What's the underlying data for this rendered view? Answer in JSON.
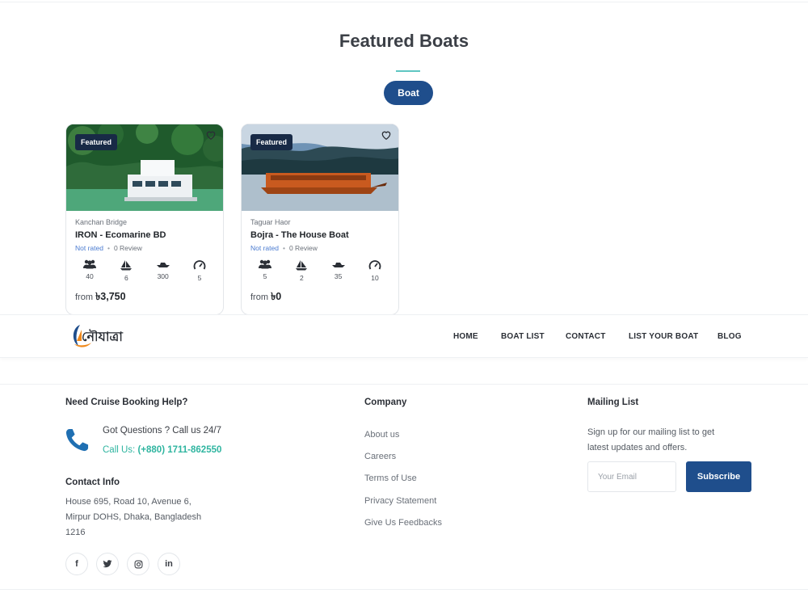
{
  "section": {
    "title": "Featured Boats",
    "filter_label": "Boat"
  },
  "boats": [
    {
      "badge": "Featured",
      "location": "Kanchan Bridge",
      "name": "IRON - Ecomarine BD",
      "rating": "Not rated",
      "reviews": "0 Review",
      "features": [
        "40",
        "6",
        "300",
        "5"
      ],
      "price_prefix": "from",
      "price": "৳3,750"
    },
    {
      "badge": "Featured",
      "location": "Taguar Haor",
      "name": "Bojra - The House Boat",
      "rating": "Not rated",
      "reviews": "0 Review",
      "features": [
        "5",
        "2",
        "35",
        "10"
      ],
      "price_prefix": "from",
      "price": "৳0"
    }
  ],
  "nav": {
    "logo_text": "নৌযাত্রা",
    "items": [
      "HOME",
      "BOAT LIST",
      "CONTACT",
      "LIST YOUR BOAT",
      "BLOG"
    ]
  },
  "footer": {
    "help_heading": "Need Cruise Booking Help?",
    "call_question": "Got Questions ? Call us 24/7",
    "call_prefix": "Call Us:",
    "call_number": "(+880) 1711-862550",
    "contact_heading": "Contact Info",
    "address_lines": [
      "House 695, Road 10, Avenue 6,",
      "Mirpur DOHS, Dhaka, Bangladesh",
      "1216"
    ],
    "company_heading": "Company",
    "company_links": [
      "About us",
      "Careers",
      "Terms of Use",
      "Privacy Statement",
      "Give Us Feedbacks"
    ],
    "mailing_heading": "Mailing List",
    "mailing_text_lines": [
      "Sign up for our mailing list to get",
      "latest updates and offers."
    ],
    "email_placeholder": "Your Email",
    "subscribe_label": "Subscribe",
    "socials": [
      "f",
      "t",
      "ig",
      "in"
    ]
  },
  "colors": {
    "primary": "#1f4e8c",
    "accent": "#5fc6c2",
    "call_green": "#2fb5a0",
    "badge": "#182a46"
  },
  "icons": [
    "heart-icon",
    "guests-icon",
    "sail-icon",
    "speedboat-icon",
    "speed-gauge-icon",
    "phone-icon",
    "facebook-icon",
    "twitter-icon",
    "instagram-icon",
    "linkedin-icon"
  ]
}
